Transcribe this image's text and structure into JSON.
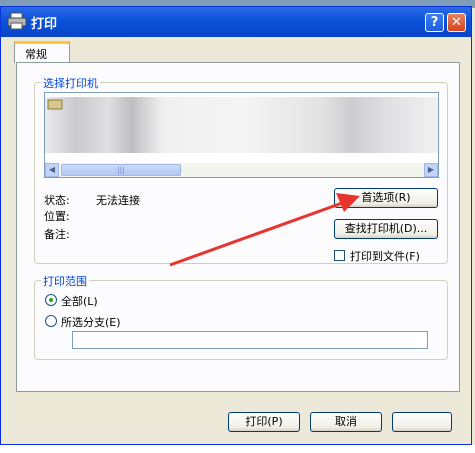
{
  "window": {
    "title": "打印"
  },
  "tabs": [
    {
      "label": "常规"
    }
  ],
  "select_printer": {
    "group_label": "选择打印机",
    "scroll_thumb_glyph": "|||"
  },
  "info": {
    "status_label": "状态:",
    "status_value": "无法连接",
    "location_label": "位置:",
    "comment_label": "备注:"
  },
  "buttons": {
    "preferences": "首选项(R)",
    "find_printer": "查找打印机(D)...",
    "print_to_file": "打印到文件(F)",
    "print": "打印(P)",
    "cancel": "取消"
  },
  "print_range": {
    "group_label": "打印范围",
    "all_label": "全部(L)",
    "selection_label": "所选分支(E)",
    "all_selected": true
  },
  "colors": {
    "titlebar": "#0a52d9",
    "group_label": "#0046d5",
    "annotation_arrow": "#e8342c"
  }
}
